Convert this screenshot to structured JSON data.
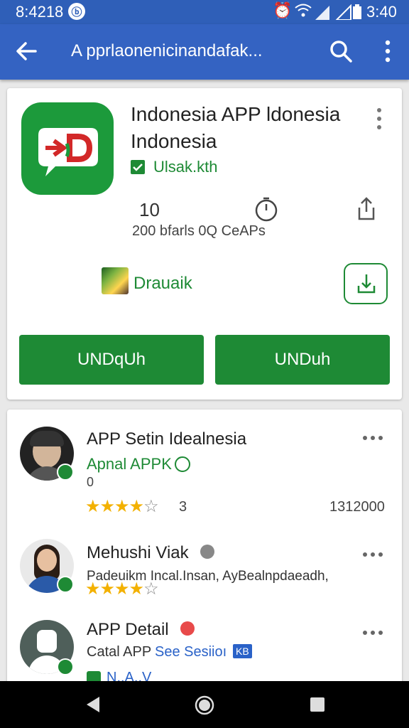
{
  "status_bar": {
    "time_left": "8:4218",
    "time_right": "3:40"
  },
  "app_bar": {
    "title": "A pprlaonenicinandafak..."
  },
  "app": {
    "name": "Indonesia APP ldonesia Indonesia",
    "developer": "Ulsak.kth",
    "stat_value": "10",
    "stat_text": "200 bfarls 0Q CeAPs",
    "badge_label": "Drauaik",
    "button1": "UNDqUh",
    "button2": "UNDuh"
  },
  "reviews": [
    {
      "name": "APP Setin Idealnesia",
      "sub": "Apnal APPK",
      "sub2": "0",
      "stars": 4,
      "star_count_text": "3",
      "date": "1312000"
    },
    {
      "name": "Mehushi Viak",
      "text": "Padeuikm Incal.Insan, AyBealnpdaeadh,",
      "stars": 4
    },
    {
      "name": "APP Detail",
      "sub_a": "Catal APP",
      "sub_b": "See Sesiioı",
      "sub_badge": "KB",
      "partial": "N..A..V"
    }
  ],
  "colors": {
    "primary": "#3463c2",
    "green": "#1e8a35",
    "star": "#f3b100"
  }
}
